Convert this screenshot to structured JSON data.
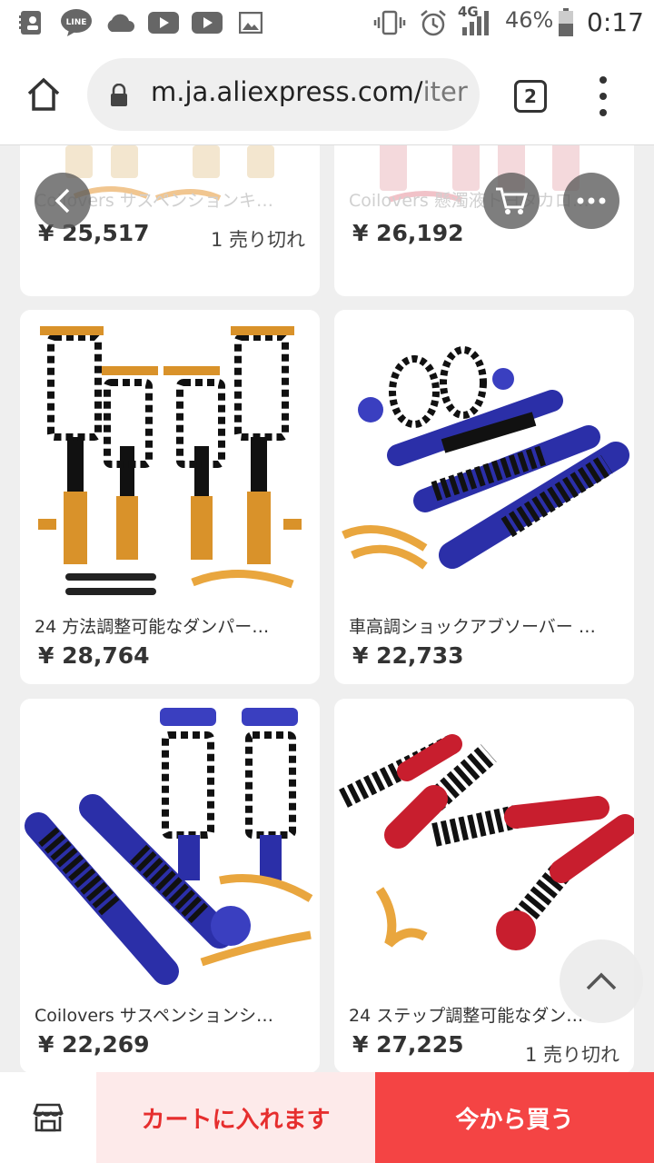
{
  "status_bar": {
    "battery_percent": "46%",
    "network": "4G",
    "time": "0:17",
    "notification_icons": [
      "contacts-icon",
      "line-icon",
      "cloud-icon",
      "youtube-icon",
      "youtube-icon",
      "gallery-icon"
    ]
  },
  "browser": {
    "url_main": "m.ja.aliexpress.com/",
    "url_faded": "iter",
    "tab_count": "2"
  },
  "products": [
    {
      "title": "Coilovers サスペンションキ…",
      "price": "¥ 25,517",
      "sold": "1 売り切れ"
    },
    {
      "title": "Coilovers 懸濁液トヨタカロ…",
      "price": "¥ 26,192",
      "sold": ""
    },
    {
      "title": "24 方法調整可能なダンパー…",
      "price": "¥ 28,764",
      "sold": ""
    },
    {
      "title": "車高調ショックアブソーバー …",
      "price": "¥ 22,733",
      "sold": ""
    },
    {
      "title": "Coilovers サスペンションシ…",
      "price": "¥ 22,269",
      "sold": ""
    },
    {
      "title": "24 ステップ調整可能なダン…",
      "price": "¥ 27,225",
      "sold": "1 売り切れ"
    }
  ],
  "bottom_bar": {
    "cart_label": "カートに入れます",
    "buy_label": "今から買う"
  },
  "colors": {
    "accent": "#f44444",
    "accent_light": "#fdeaea",
    "gold": "#d9922a",
    "blue": "#2b2fa8",
    "red": "#c81e2e"
  }
}
